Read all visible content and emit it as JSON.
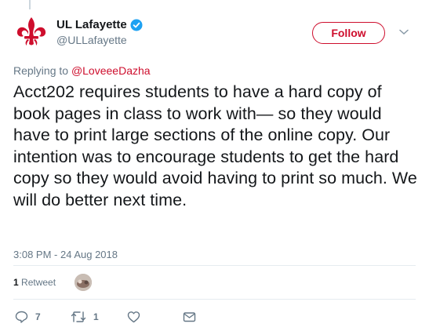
{
  "account": {
    "display_name": "UL Lafayette",
    "handle": "@ULLafayette",
    "verified": true,
    "brand_color": "#ce0e2d"
  },
  "follow_button": {
    "label": "Follow"
  },
  "reply": {
    "prefix": "Replying to",
    "mention": "@LoveeeDazha"
  },
  "tweet": {
    "text": "Acct202 requires students to have a hard copy of book pages in class to work with— so they would have to print large sections of the online copy. Our intention was to encourage students to get the hard copy so they would avoid having to print so much. We will do better next time.",
    "timestamp": "3:08 PM - 24 Aug 2018"
  },
  "stats": {
    "retweet_count": "1",
    "retweet_label": "Retweet"
  },
  "actions": {
    "reply_count": "7",
    "retweet_count": "1",
    "like_count": "",
    "icons": [
      "reply-icon",
      "retweet-icon",
      "like-icon",
      "message-icon"
    ]
  }
}
